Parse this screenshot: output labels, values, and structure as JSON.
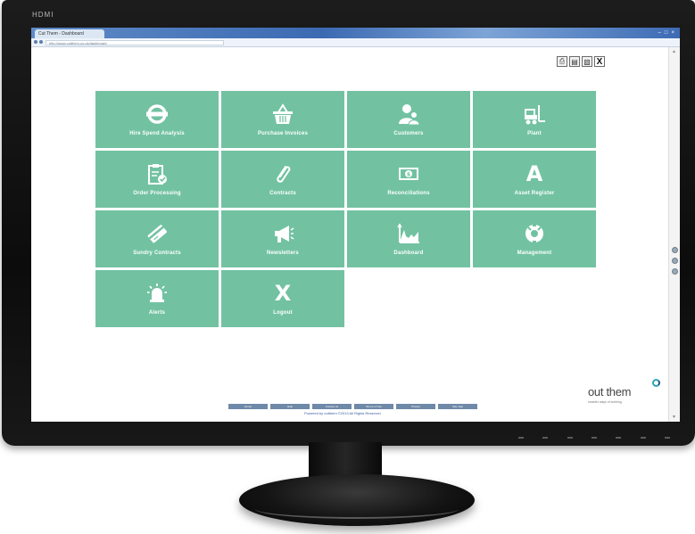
{
  "monitor": {
    "brand": "HDMI"
  },
  "browser": {
    "tab_title": "Cut Them - Dashboard",
    "window_controls": [
      "–",
      "□",
      "×"
    ],
    "address": "http://www.cutthem.co.uk/dashboard"
  },
  "toolbar": {
    "tools": [
      {
        "icon": "print-icon",
        "glyph": "⎙"
      },
      {
        "icon": "document-icon",
        "glyph": "▤"
      },
      {
        "icon": "image-icon",
        "glyph": "▧"
      },
      {
        "icon": "close-icon",
        "glyph": "X"
      }
    ]
  },
  "tiles": [
    {
      "label": "Hire Spend Analysis",
      "icon": "transport-roundel"
    },
    {
      "label": "Purchase Invoices",
      "icon": "shopping-basket"
    },
    {
      "label": "Customers",
      "icon": "users"
    },
    {
      "label": "Plant",
      "icon": "forklift"
    },
    {
      "label": "Order Processing",
      "icon": "clipboard-check"
    },
    {
      "label": "Contracts",
      "icon": "paperclip"
    },
    {
      "label": "Reconciliations",
      "icon": "cash"
    },
    {
      "label": "Asset Register",
      "icon": "letter-a"
    },
    {
      "label": "Sundry Contracts",
      "icon": "card"
    },
    {
      "label": "Newsletters",
      "icon": "megaphone"
    },
    {
      "label": "Dashboard",
      "icon": "growth-chart"
    },
    {
      "label": "Management",
      "icon": "settings-wrench"
    },
    {
      "label": "Alerts",
      "icon": "alarm-bell"
    },
    {
      "label": "Logout",
      "icon": "letter-x"
    }
  ],
  "footer": {
    "buttons": [
      "Home",
      "Help",
      "Contact us",
      "Terms of Use",
      "Privacy",
      "Site map"
    ],
    "link": "Powered by outthem ©2013 All Rights Reserved"
  },
  "logo": {
    "text": "out them",
    "tagline": "smarter ways of working"
  },
  "colors": {
    "tile": "#72c2a2",
    "footer_button": "#6f89a8",
    "logo_accent": "#2fa6b8"
  }
}
